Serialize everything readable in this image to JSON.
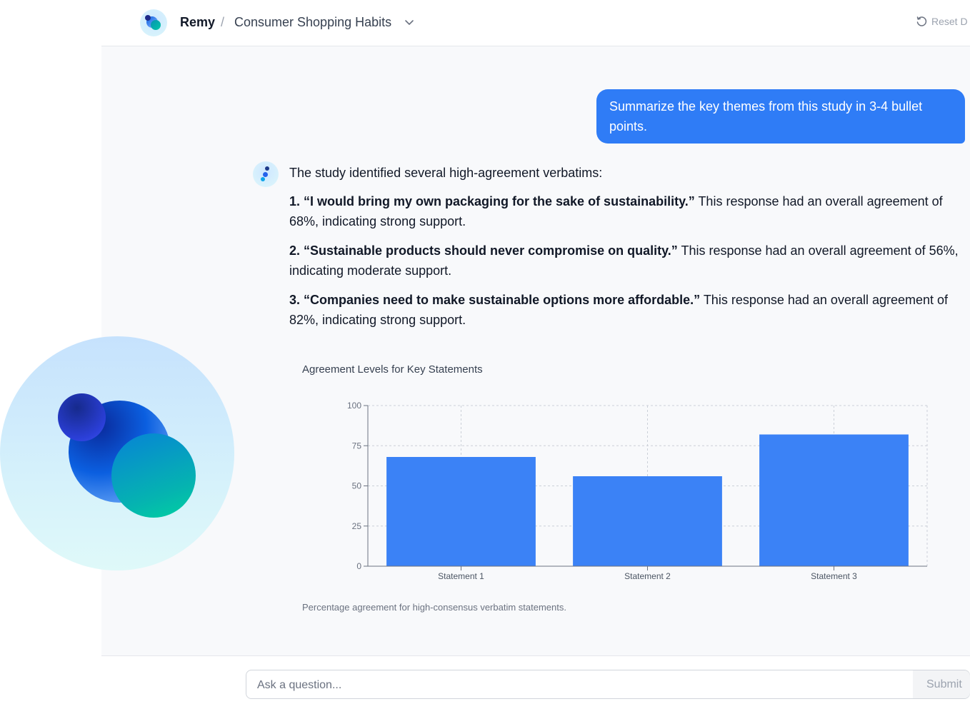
{
  "header": {
    "app_name": "Remy",
    "separator": "/",
    "study_title": "Consumer Shopping Habits",
    "reset_label": "Reset D"
  },
  "conversation": {
    "user_message": "Summarize the key themes from this study in 3-4 bullet points.",
    "assistant": {
      "intro": "The study identified several high-agreement verbatims:",
      "items": [
        {
          "quote": "1. “I would bring my own packaging for the sake of sustainability.”",
          "text": " This response had an overall agreement of 68%, indicating strong support."
        },
        {
          "quote": "2. “Sustainable products should never compromise on quality.”",
          "text": " This response had an overall agreement of 56%, indicating moderate support."
        },
        {
          "quote": "3. “Companies need to make sustainable options more affordable.”",
          "text": " This response had an overall agreement of 82%, indicating strong support."
        }
      ]
    }
  },
  "chart_data": {
    "type": "bar",
    "title": "Agreement Levels for Key Statements",
    "caption": "Percentage agreement for high-consensus verbatim statements.",
    "categories": [
      "Statement 1",
      "Statement 2",
      "Statement 3"
    ],
    "values": [
      68,
      56,
      82
    ],
    "ylim": [
      0,
      100
    ],
    "yticks": [
      0,
      25,
      50,
      75,
      100
    ],
    "grid": true,
    "bar_color": "#3b82f6"
  },
  "input": {
    "placeholder": "Ask a question...",
    "submit_label": "Submit"
  },
  "colors": {
    "accent": "#2f7cf6",
    "background": "#f8f9fb"
  }
}
